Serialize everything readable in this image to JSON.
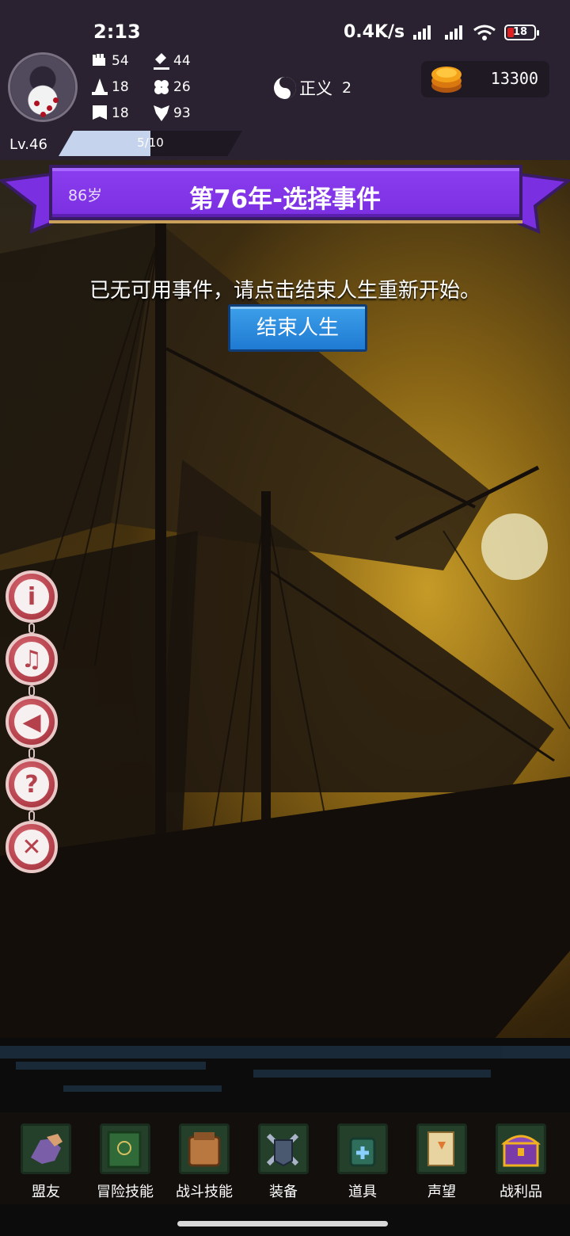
{
  "status_bar": {
    "time": "2:13",
    "network_speed": "0.4K/s",
    "battery_level": "18",
    "icons": [
      "hd-signal-icon",
      "hd-signal-icon",
      "wifi-icon",
      "battery-icon"
    ]
  },
  "player": {
    "stats": [
      {
        "icon": "fist-icon",
        "value": "54"
      },
      {
        "icon": "hammer-icon",
        "value": "44"
      },
      {
        "icon": "witch-hat-icon",
        "value": "18"
      },
      {
        "icon": "clover-icon",
        "value": "26"
      },
      {
        "icon": "banner-icon",
        "value": "18"
      },
      {
        "icon": "wings-icon",
        "value": "93"
      }
    ],
    "alignment": {
      "label": "正义",
      "value": "2"
    },
    "coins": "13300",
    "level": "Lv.46",
    "xp": {
      "text": "5/10",
      "fraction": 0.5
    }
  },
  "banner": {
    "age": "86岁",
    "title": "第76年-选择事件"
  },
  "event": {
    "message": "已无可用事件，请点击结束人生重新开始。",
    "end_button": "结束人生"
  },
  "side_menu": [
    {
      "icon": "info-icon",
      "glyph": "i"
    },
    {
      "icon": "music-icon",
      "glyph": "♫"
    },
    {
      "icon": "speaker-icon",
      "glyph": "◀"
    },
    {
      "icon": "help-icon",
      "glyph": "?"
    },
    {
      "icon": "close-icon",
      "glyph": "✕"
    }
  ],
  "bottom_tabs": [
    {
      "label": "盟友",
      "icon": "allies-icon"
    },
    {
      "label": "冒险技能",
      "icon": "adventure-skill-book-icon"
    },
    {
      "label": "战斗技能",
      "icon": "combat-skill-bag-icon"
    },
    {
      "label": "装备",
      "icon": "equipment-swords-icon"
    },
    {
      "label": "道具",
      "icon": "items-pouch-icon"
    },
    {
      "label": "声望",
      "icon": "reputation-scroll-icon"
    },
    {
      "label": "战利品",
      "icon": "loot-chest-icon"
    }
  ],
  "colors": {
    "hud_bg": "#2a2230",
    "banner_purple": "#7a2fe0",
    "button_blue": "#1f7ad2",
    "side_button_red": "#b4414c"
  }
}
